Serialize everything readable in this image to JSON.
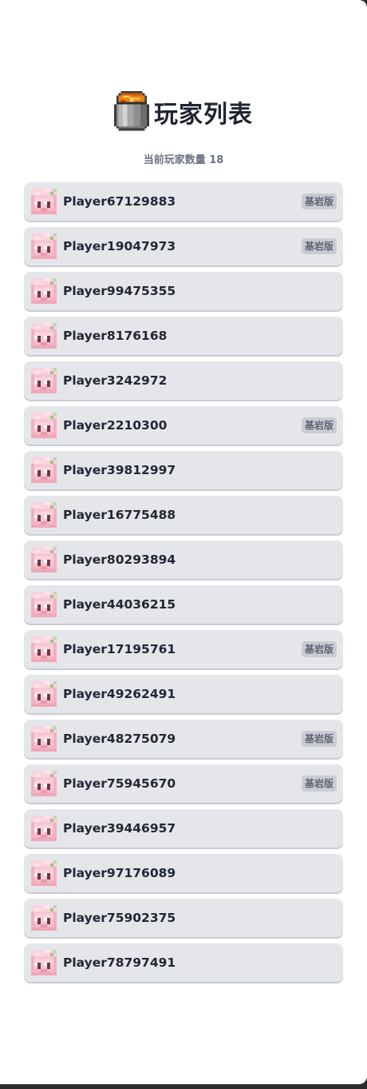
{
  "header": {
    "icon": "lava-bucket-icon",
    "title": "玩家列表"
  },
  "summary": {
    "count_label": "当前玩家数量 18"
  },
  "players": [
    {
      "name": "Player67129883",
      "badge": "基岩版"
    },
    {
      "name": "Player19047973",
      "badge": "基岩版"
    },
    {
      "name": "Player99475355",
      "badge": ""
    },
    {
      "name": "Player8176168",
      "badge": ""
    },
    {
      "name": "Player3242972",
      "badge": ""
    },
    {
      "name": "Player2210300",
      "badge": "基岩版"
    },
    {
      "name": "Player39812997",
      "badge": ""
    },
    {
      "name": "Player16775488",
      "badge": ""
    },
    {
      "name": "Player80293894",
      "badge": ""
    },
    {
      "name": "Player44036215",
      "badge": ""
    },
    {
      "name": "Player17195761",
      "badge": "基岩版"
    },
    {
      "name": "Player49262491",
      "badge": ""
    },
    {
      "name": "Player48275079",
      "badge": "基岩版"
    },
    {
      "name": "Player75945670",
      "badge": "基岩版"
    },
    {
      "name": "Player39446957",
      "badge": ""
    },
    {
      "name": "Player97176089",
      "badge": ""
    },
    {
      "name": "Player75902375",
      "badge": ""
    },
    {
      "name": "Player78797491",
      "badge": ""
    }
  ],
  "colors": {
    "row_bg": "#e4e6ea",
    "badge_bg": "#c9ccd2",
    "title": "#1f2430",
    "subtle_text": "#6b7280"
  }
}
